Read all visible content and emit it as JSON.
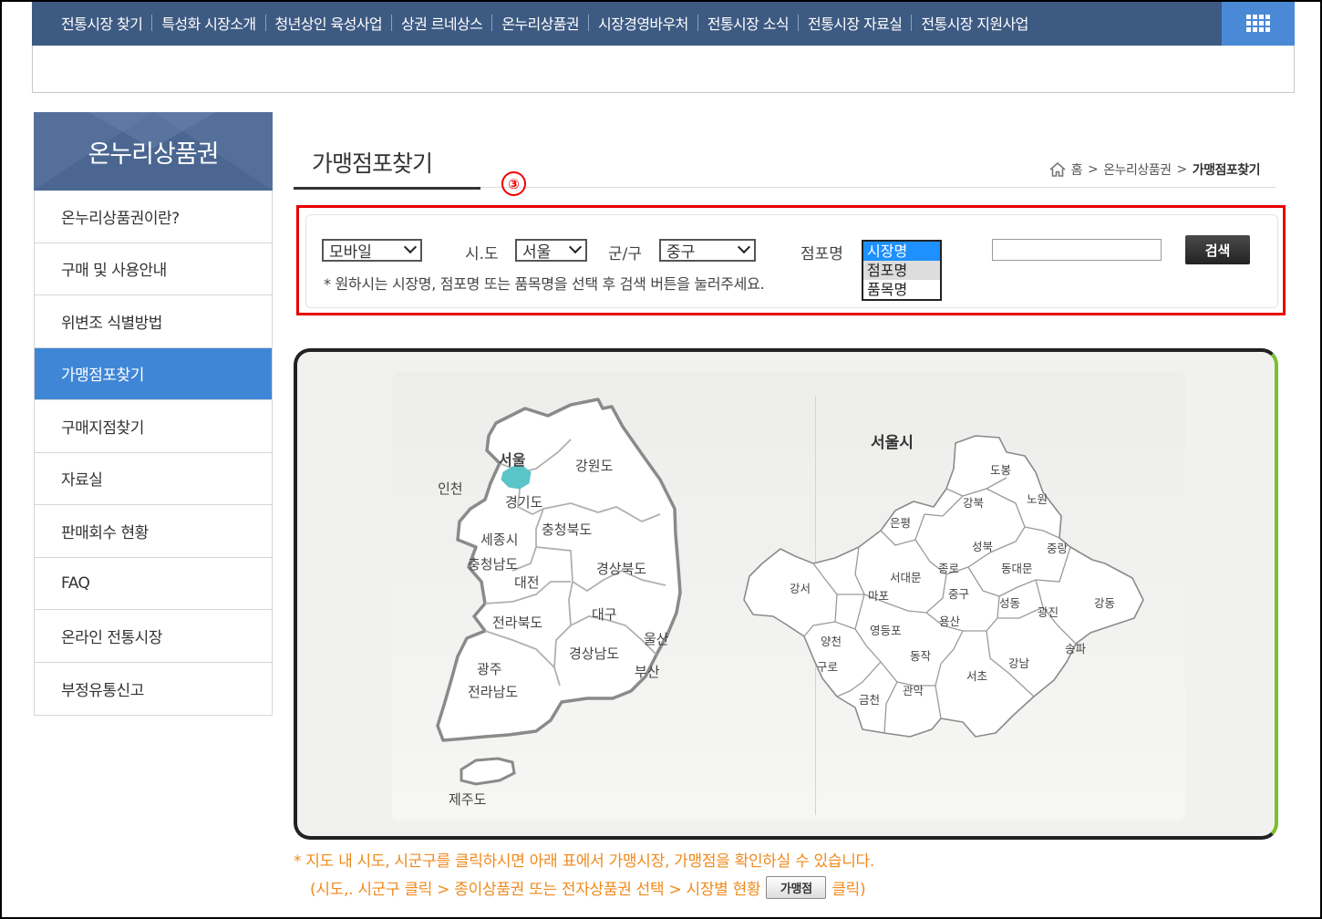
{
  "topnav": {
    "items": [
      "전통시장 찾기",
      "특성화 시장소개",
      "청년상인 육성사업",
      "상권 르네상스",
      "온누리상품권",
      "시장경영바우처",
      "전통시장 소식",
      "전통시장 자료실",
      "전통시장 지원사업"
    ],
    "all_menu_icon": "grid-icon",
    "bar_color": "#3d5a82",
    "accent_color": "#4a89d6"
  },
  "sidebar": {
    "title": "온누리상품권",
    "items": [
      {
        "label": "온누리상품권이란?",
        "active": false
      },
      {
        "label": "구매 및 사용안내",
        "active": false
      },
      {
        "label": "위변조 식별방법",
        "active": false
      },
      {
        "label": "가맹점포찾기",
        "active": true
      },
      {
        "label": "구매지점찾기",
        "active": false
      },
      {
        "label": "자료실",
        "active": false
      },
      {
        "label": "판매회수 현황",
        "active": false
      },
      {
        "label": "FAQ",
        "active": false
      },
      {
        "label": "온라인 전통시장",
        "active": false
      },
      {
        "label": "부정유통신고",
        "active": false
      }
    ]
  },
  "page": {
    "title": "가맹점포찾기",
    "breadcrumb": {
      "home": "홈",
      "parent": "온누리상품권",
      "current": "가맹점포찾기"
    },
    "marker": "③"
  },
  "search": {
    "type_value": "모바일",
    "sido_label": "시.도",
    "sido_value": "서울",
    "gugun_label": "군/구",
    "gugun_value": "중구",
    "store_label": "점포명",
    "options": [
      "시장명",
      "점포명",
      "품목명"
    ],
    "hint": "* 원하시는 시장명, 점포명 또는 품목명을 선택 후 검색 버튼을 눌러주세요.",
    "input_value": "",
    "button": "검색"
  },
  "korea_map": {
    "regions": [
      "서울",
      "인천",
      "강원도",
      "경기도",
      "충청북도",
      "세종시",
      "충청남도",
      "대전",
      "경상북도",
      "대구",
      "전라북도",
      "울산",
      "경상남도",
      "광주",
      "부산",
      "전라남도",
      "제주도"
    ],
    "selected": "서울",
    "selected_color": "#5bc4c9"
  },
  "seoul_map": {
    "title": "서울시",
    "districts": [
      "도봉",
      "노원",
      "강북",
      "은평",
      "성북",
      "중랑",
      "종로",
      "동대문",
      "서대문",
      "강서",
      "마포",
      "중구",
      "성동",
      "광진",
      "강동",
      "용산",
      "양천",
      "영등포",
      "동작",
      "송파",
      "구로",
      "강남",
      "서초",
      "관악",
      "금천"
    ]
  },
  "notes": {
    "line1": "* 지도 내 시도, 시군구를 클릭하시면 아래 표에서 가맹시장, 가맹점을 확인하실 수 있습니다.",
    "line2_prefix": "(시도,. 시군구 클릭 > 종이상품권 또는 전자상품권 선택 > 시장별 현황",
    "button": "가맹점",
    "line2_suffix": "클릭)"
  }
}
